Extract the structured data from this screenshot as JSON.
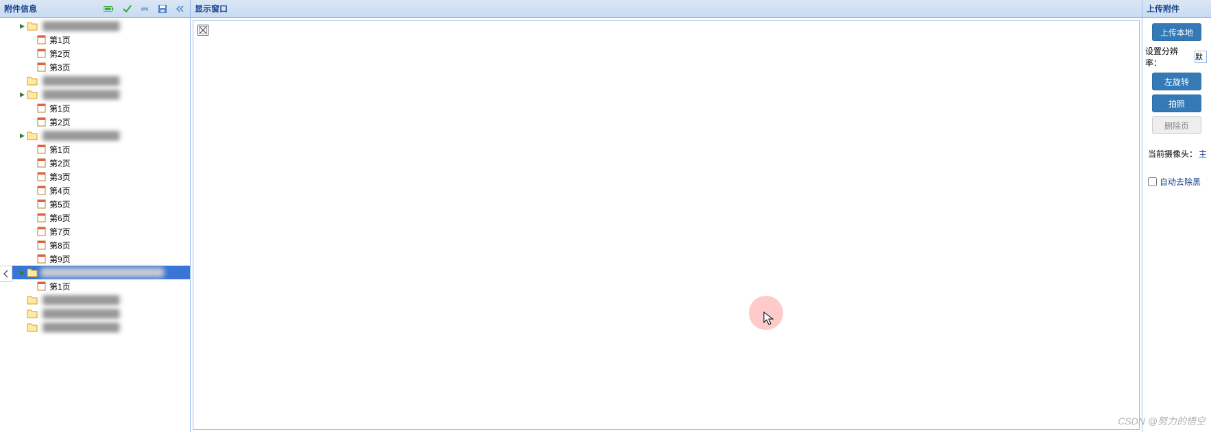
{
  "left": {
    "title": "附件信息",
    "folders": [
      {
        "label_redacted": true,
        "pages": [
          "第1页",
          "第2页",
          "第3页"
        ]
      },
      {
        "label_redacted": true,
        "pages": []
      },
      {
        "label_redacted": true,
        "pages": [
          "第1页",
          "第2页"
        ]
      },
      {
        "label_redacted": true,
        "pages": [
          "第1页",
          "第2页",
          "第3页",
          "第4页",
          "第5页",
          "第6页",
          "第7页",
          "第8页",
          "第9页"
        ]
      },
      {
        "label_redacted": true,
        "selected": true,
        "pages": [
          "第1页"
        ]
      },
      {
        "label_redacted": true,
        "pages": []
      },
      {
        "label_redacted": true,
        "pages": []
      },
      {
        "label_redacted": true,
        "pages": []
      }
    ],
    "toolbar_icons": [
      "battery",
      "check",
      "print",
      "save",
      "collapse"
    ]
  },
  "center": {
    "title": "显示窗口"
  },
  "right": {
    "title": "上传附件",
    "upload_btn": "上传本地",
    "resolution_label": "设置分辨率：",
    "resolution_value": "默",
    "rotate_left_btn": "左旋转",
    "capture_btn": "拍照",
    "delete_btn": "删除页",
    "camera_label": "当前摄像头：",
    "camera_value": "主",
    "auto_remove_black": "自动去除黑"
  },
  "watermark": "CSDN @努力的悟空"
}
